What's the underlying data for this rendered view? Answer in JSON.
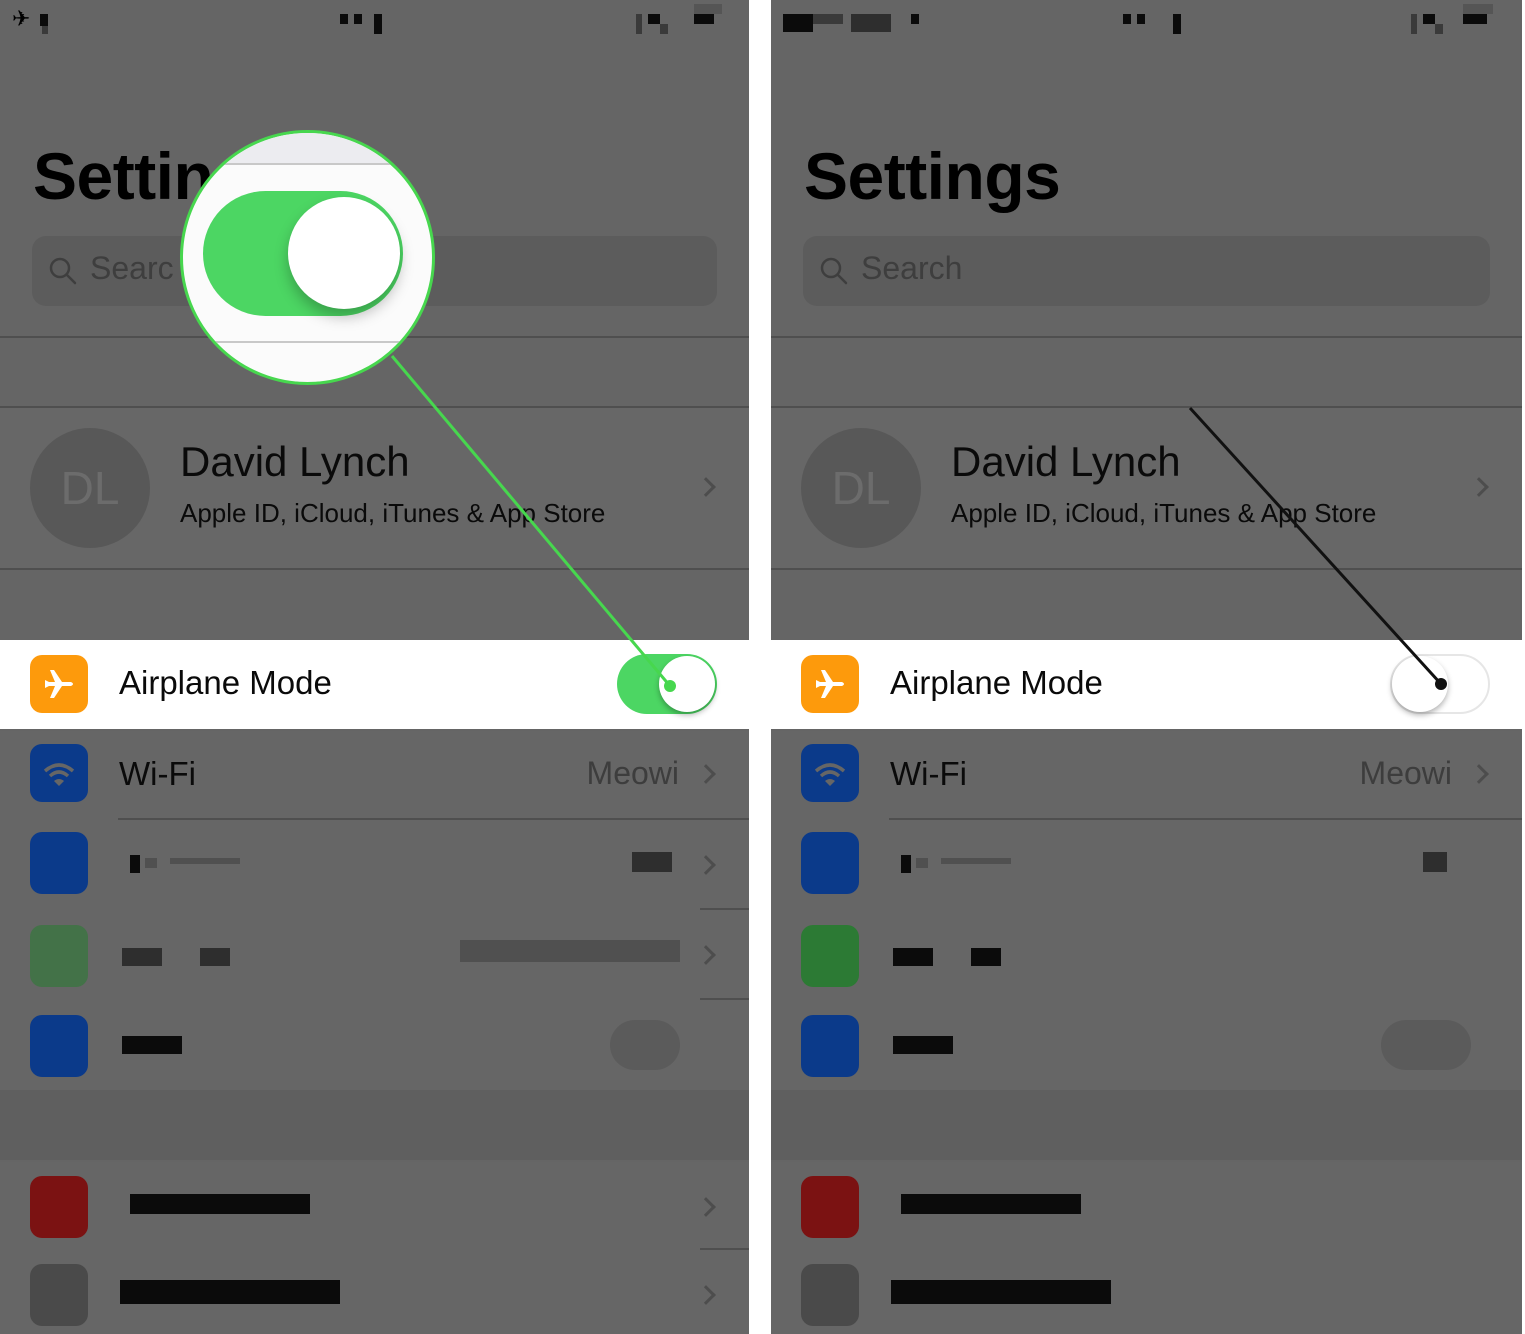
{
  "panels": [
    {
      "id": "left",
      "state": "airplane-mode-on",
      "title": "Settings",
      "title_visible_fragment": "Settin",
      "search": {
        "placeholder": "Search",
        "visible_fragment": "Searc"
      },
      "profile": {
        "initials": "DL",
        "name": "David Lynch",
        "subtitle": "Apple ID, iCloud, iTunes & App Store"
      },
      "airplane_mode": {
        "label": "Airplane Mode",
        "toggle_on": true,
        "icon": "airplane-icon",
        "icon_color": "#fd9a0c"
      },
      "wifi": {
        "label": "Wi-Fi",
        "value": "Meowi",
        "icon": "wifi-icon",
        "icon_color": "#0b3a8a"
      },
      "callout_color": "#47d74e"
    },
    {
      "id": "right",
      "state": "airplane-mode-off",
      "title": "Settings",
      "search": {
        "placeholder": "Search"
      },
      "profile": {
        "initials": "DL",
        "name": "David Lynch",
        "subtitle": "Apple ID, iCloud, iTunes & App Store"
      },
      "airplane_mode": {
        "label": "Airplane Mode",
        "toggle_on": false,
        "icon": "airplane-icon",
        "icon_color": "#fd9a0c"
      },
      "wifi": {
        "label": "Wi-Fi",
        "value": "Meowi",
        "icon": "wifi-icon",
        "icon_color": "#0b3a8a"
      },
      "callout_color": "#111111"
    }
  ],
  "blurred_rows": [
    {
      "icon": "bluetooth-icon",
      "icon_color": "#0b3a8a"
    },
    {
      "icon": "cellular-icon",
      "icon_color": "#2c7a34"
    },
    {
      "icon": "vpn-icon",
      "icon_color": "#0b3a8a"
    },
    {
      "icon": "notifications-icon",
      "icon_color": "#7b1212"
    },
    {
      "icon": "control-center-icon",
      "icon_color": "#4a4a4a"
    }
  ],
  "colors": {
    "dim_overlay": "#656565",
    "toggle_on": "#4cd663",
    "highlight_row": "#ffffff"
  }
}
